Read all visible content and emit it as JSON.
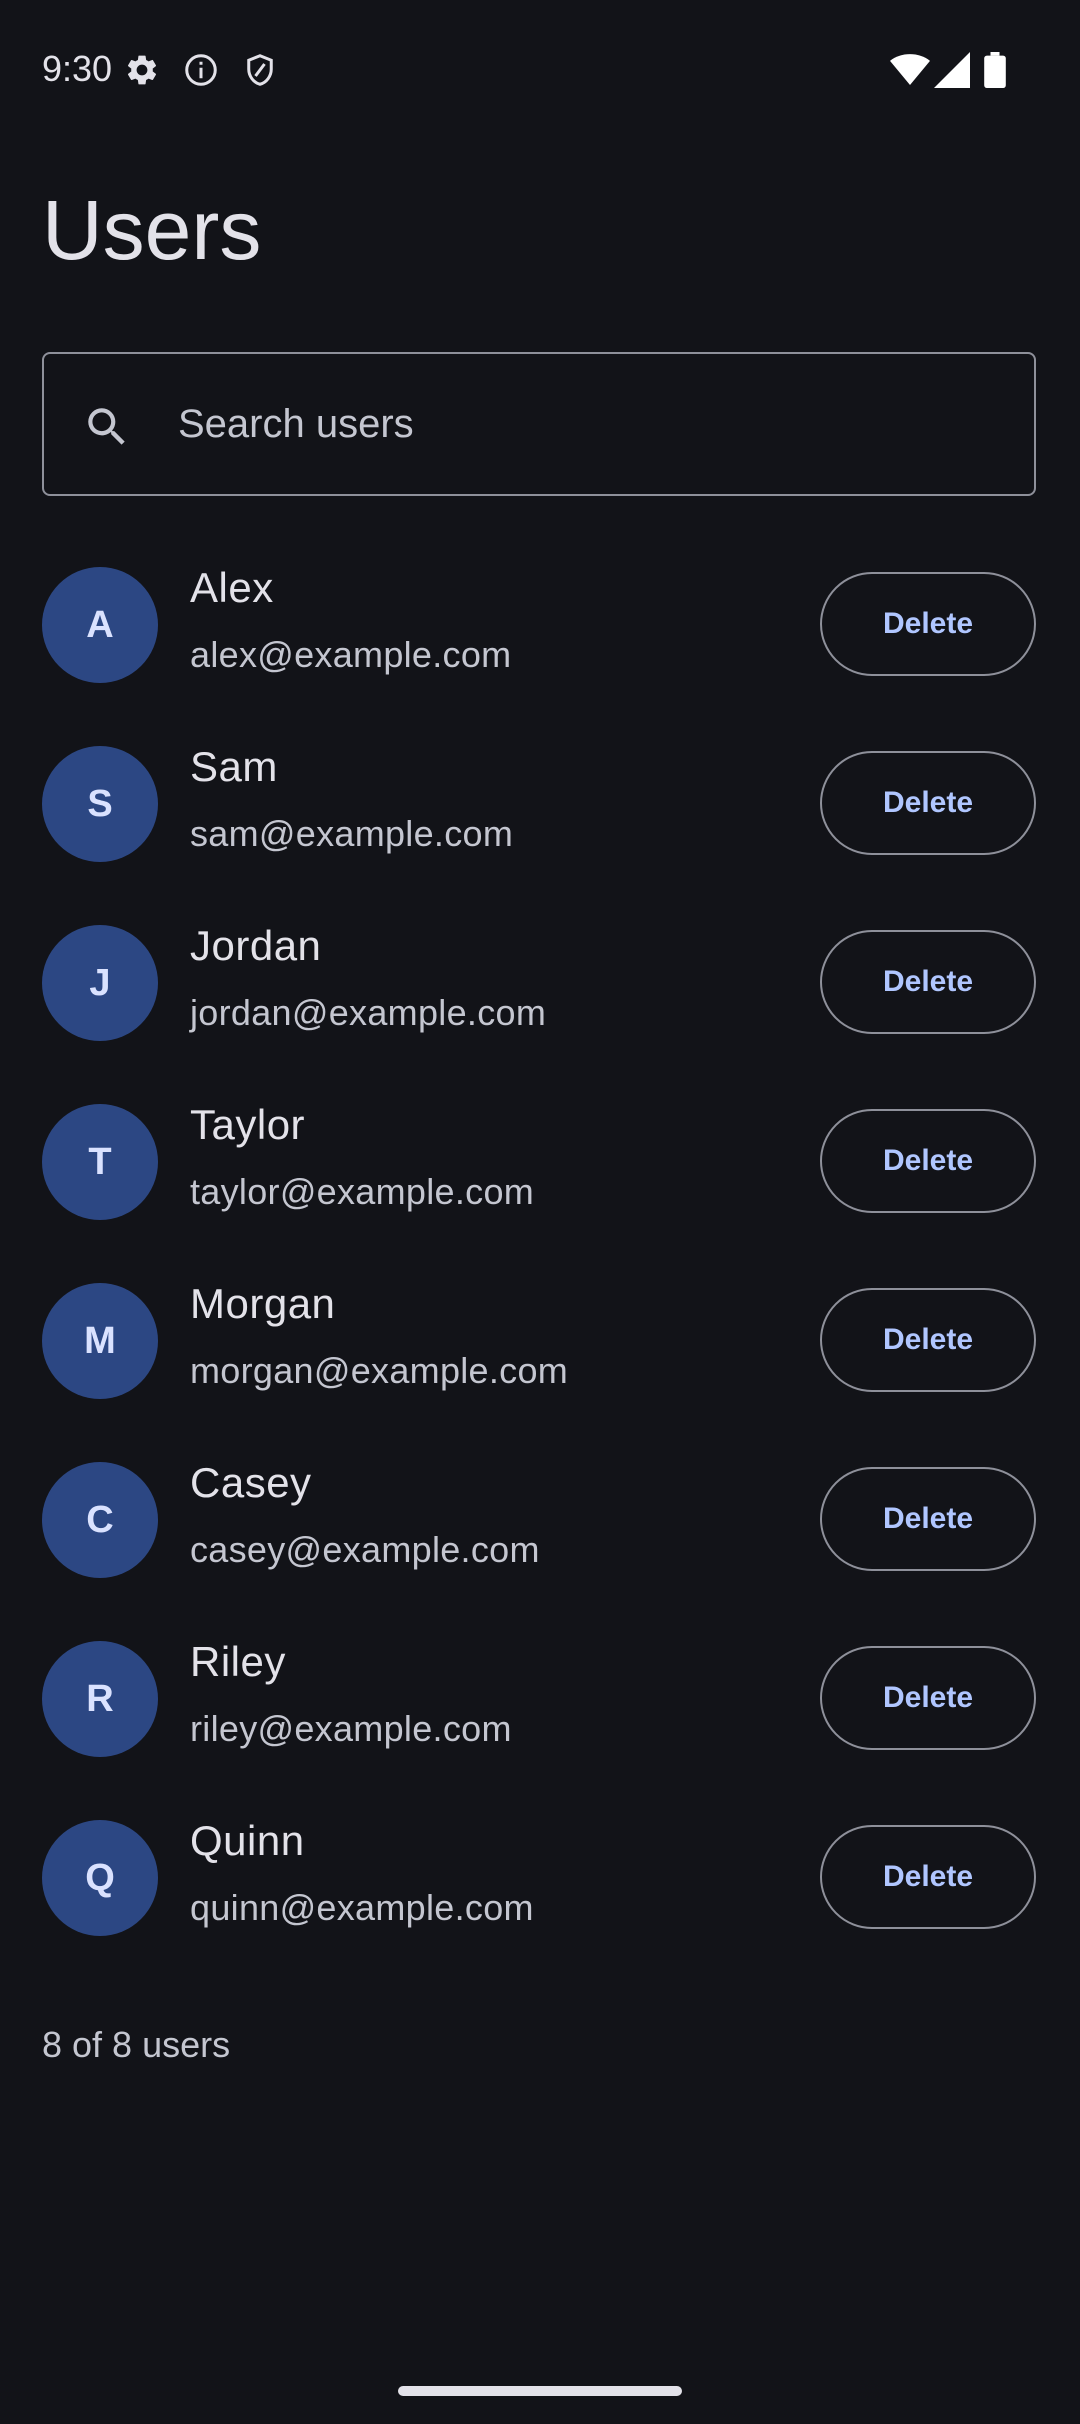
{
  "status_bar": {
    "time": "9:30",
    "left_icons": [
      "settings-icon",
      "info-icon",
      "shield-icon"
    ],
    "right_icons": [
      "wifi-icon",
      "signal-icon",
      "battery-icon"
    ]
  },
  "page": {
    "title": "Users"
  },
  "search": {
    "placeholder": "Search users",
    "value": ""
  },
  "users": [
    {
      "initial": "A",
      "name": "Alex",
      "email": "alex@example.com",
      "action": "Delete"
    },
    {
      "initial": "S",
      "name": "Sam",
      "email": "sam@example.com",
      "action": "Delete"
    },
    {
      "initial": "J",
      "name": "Jordan",
      "email": "jordan@example.com",
      "action": "Delete"
    },
    {
      "initial": "T",
      "name": "Taylor",
      "email": "taylor@example.com",
      "action": "Delete"
    },
    {
      "initial": "M",
      "name": "Morgan",
      "email": "morgan@example.com",
      "action": "Delete"
    },
    {
      "initial": "C",
      "name": "Casey",
      "email": "casey@example.com",
      "action": "Delete"
    },
    {
      "initial": "R",
      "name": "Riley",
      "email": "riley@example.com",
      "action": "Delete"
    },
    {
      "initial": "Q",
      "name": "Quinn",
      "email": "quinn@example.com",
      "action": "Delete"
    }
  ],
  "footer": {
    "count_text": "8 of 8 users"
  },
  "colors": {
    "background": "#121318",
    "avatar": "#2c4783",
    "accent": "#b0c6ff",
    "outline": "#8e909a"
  }
}
